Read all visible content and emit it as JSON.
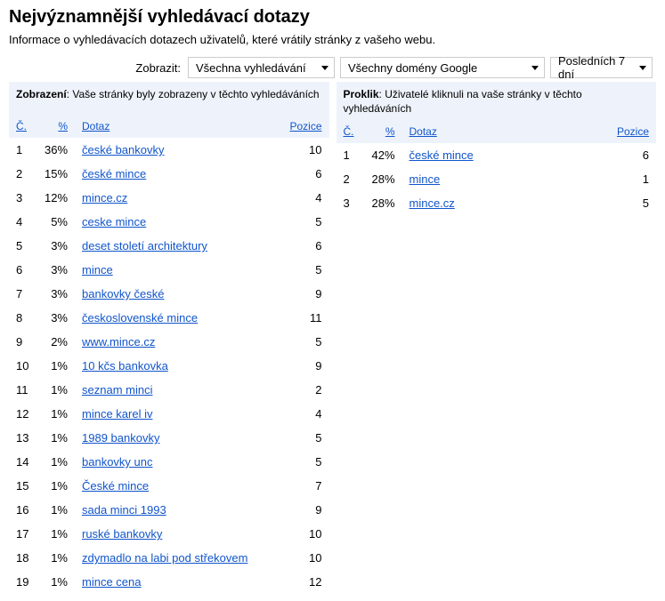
{
  "title": "Nejvýznamnější vyhledávací dotazy",
  "subtitle": "Informace o vyhledávacích dotazech uživatelů, které vrátily stránky z vašeho webu.",
  "filters": {
    "label": "Zobrazit:",
    "search_type": "Všechna vyhledávání",
    "domain": "Všechny domény Google",
    "period": "Posledních 7 dní"
  },
  "headers": {
    "rank": "Č.",
    "pct": "%",
    "query": "Dotaz",
    "position": "Pozice"
  },
  "impressions": {
    "title": "Zobrazení",
    "desc": ": Vaše stránky byly zobrazeny v těchto vyhledáváních",
    "rows": [
      {
        "rank": 1,
        "pct": "36%",
        "query": "české bankovky",
        "pos": 10
      },
      {
        "rank": 2,
        "pct": "15%",
        "query": "české mince",
        "pos": 6
      },
      {
        "rank": 3,
        "pct": "12%",
        "query": "mince.cz",
        "pos": 4
      },
      {
        "rank": 4,
        "pct": "5%",
        "query": "ceske mince",
        "pos": 5
      },
      {
        "rank": 5,
        "pct": "3%",
        "query": "deset století architektury",
        "pos": 6
      },
      {
        "rank": 6,
        "pct": "3%",
        "query": "mince",
        "pos": 5
      },
      {
        "rank": 7,
        "pct": "3%",
        "query": "bankovky české",
        "pos": 9
      },
      {
        "rank": 8,
        "pct": "3%",
        "query": "československé mince",
        "pos": 11
      },
      {
        "rank": 9,
        "pct": "2%",
        "query": "www.mince.cz",
        "pos": 5
      },
      {
        "rank": 10,
        "pct": "1%",
        "query": "10 kčs bankovka",
        "pos": 9
      },
      {
        "rank": 11,
        "pct": "1%",
        "query": "seznam minci",
        "pos": 2
      },
      {
        "rank": 12,
        "pct": "1%",
        "query": "mince karel iv",
        "pos": 4
      },
      {
        "rank": 13,
        "pct": "1%",
        "query": "1989 bankovky",
        "pos": 5
      },
      {
        "rank": 14,
        "pct": "1%",
        "query": "bankovky unc",
        "pos": 5
      },
      {
        "rank": 15,
        "pct": "1%",
        "query": "České mince",
        "pos": 7
      },
      {
        "rank": 16,
        "pct": "1%",
        "query": "sada minci 1993",
        "pos": 9
      },
      {
        "rank": 17,
        "pct": "1%",
        "query": "ruské bankovky",
        "pos": 10
      },
      {
        "rank": 18,
        "pct": "1%",
        "query": "zdymadlo na labi pod střekovem",
        "pos": 10
      },
      {
        "rank": 19,
        "pct": "1%",
        "query": "mince cena",
        "pos": 12
      }
    ]
  },
  "clicks": {
    "title": "Proklik",
    "desc": ": Uživatelé kliknuli na vaše stránky v těchto vyhledáváních",
    "rows": [
      {
        "rank": 1,
        "pct": "42%",
        "query": "české mince",
        "pos": 6
      },
      {
        "rank": 2,
        "pct": "28%",
        "query": "mince",
        "pos": 1
      },
      {
        "rank": 3,
        "pct": "28%",
        "query": "mince.cz",
        "pos": 5
      }
    ]
  }
}
